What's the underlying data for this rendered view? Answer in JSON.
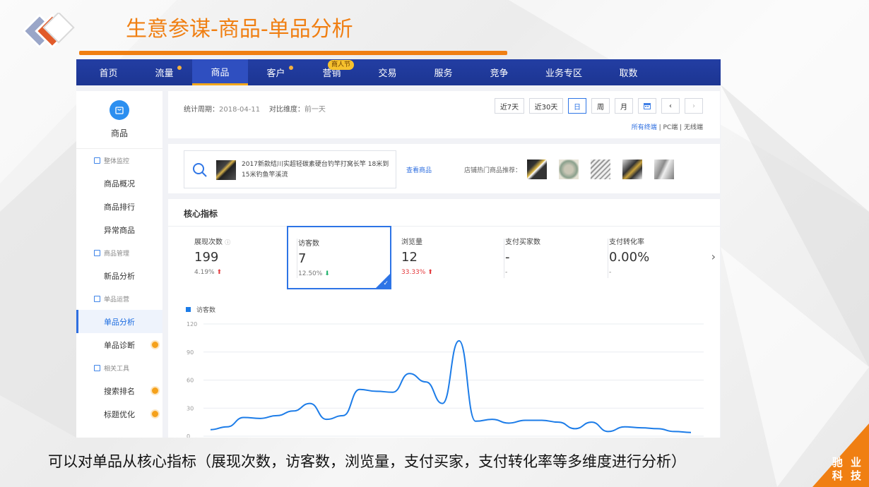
{
  "slide": {
    "title": "生意参谋-商品-单品分析",
    "caption": "可以对单品从核心指标（展现次数，访客数，浏览量，支付买家，支付转化率等多维度进行分析）",
    "corner_line1": "驰 业",
    "corner_line2": "科 技",
    "accent_color": "#f07f12"
  },
  "nav": {
    "items": [
      {
        "label": "首页"
      },
      {
        "label": "流量"
      },
      {
        "label": "商品"
      },
      {
        "label": "客户"
      },
      {
        "label": "营销"
      },
      {
        "label": "交易"
      },
      {
        "label": "服务"
      },
      {
        "label": "竞争"
      },
      {
        "label": "业务专区"
      },
      {
        "label": "取数"
      }
    ],
    "badge": "商人节"
  },
  "sidebar": {
    "title": "商品",
    "groups": [
      {
        "label": "整体监控",
        "items": [
          "商品概况",
          "商品排行",
          "异常商品"
        ]
      },
      {
        "label": "商品管理",
        "items": [
          "新品分析"
        ]
      },
      {
        "label": "单品运营",
        "items": [
          "单品分析",
          "单品诊断"
        ]
      },
      {
        "label": "相关工具",
        "items": [
          "搜索排名",
          "标题优化"
        ]
      }
    ]
  },
  "filters": {
    "period_label": "统计周期：",
    "period_value": "2018-04-11",
    "compare_label": "对比维度：",
    "compare_value": "前一天",
    "buttons": [
      "近7天",
      "近30天",
      "日",
      "周",
      "月"
    ],
    "terminal_all": "所有终端",
    "terminal_pc": "PC端",
    "terminal_wireless": "无线端"
  },
  "product": {
    "name": "2017新款结川实超轻碳素硬台钓竿打窝长竿 18米到15米钓鱼竿溪流",
    "view_link": "查看商品",
    "recommend_label": "店铺热门商品推荐："
  },
  "core": {
    "title": "核心指标",
    "metrics": [
      {
        "label": "展现次数",
        "value": "199",
        "delta": "4.19%"
      },
      {
        "label": "访客数",
        "value": "7",
        "delta": "12.50%"
      },
      {
        "label": "浏览量",
        "value": "12",
        "delta": "33.33%"
      },
      {
        "label": "支付买家数",
        "value": "-",
        "delta": "-"
      },
      {
        "label": "支付转化率",
        "value": "0.00%",
        "delta": "-"
      }
    ]
  },
  "chart_data": {
    "type": "line",
    "series": [
      {
        "name": "访客数",
        "values": [
          7,
          10,
          20,
          19,
          22,
          27,
          35,
          18,
          22,
          50,
          48,
          47,
          67,
          58,
          35,
          102,
          16,
          18,
          14,
          17,
          17,
          15,
          8,
          15,
          5,
          10,
          9,
          8,
          5,
          4
        ]
      }
    ],
    "y_ticks": [
      "0",
      "30",
      "60",
      "90",
      "120"
    ],
    "ylim": [
      0,
      120
    ],
    "color": "#1c7ce8",
    "grid": true
  }
}
